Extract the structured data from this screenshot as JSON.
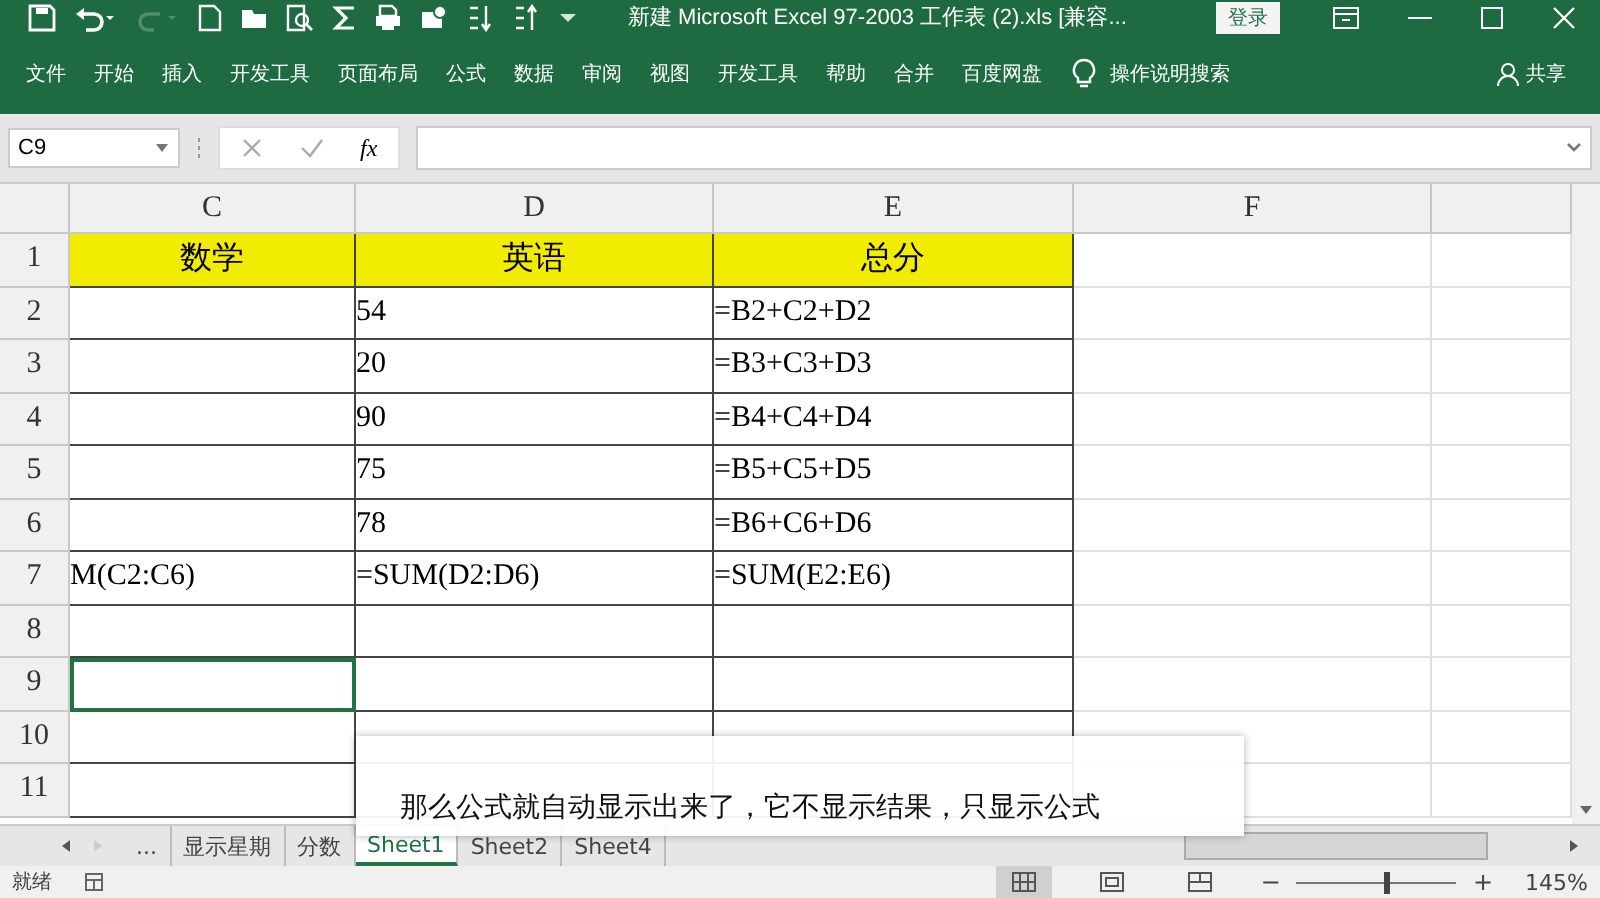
{
  "window": {
    "title": "新建 Microsoft Excel 97-2003 工作表 (2).xls  [兼容...",
    "login": "登录"
  },
  "ribbon_tabs": [
    {
      "label": "文件"
    },
    {
      "label": "开始"
    },
    {
      "label": "插入"
    },
    {
      "label": "开发工具"
    },
    {
      "label": "页面布局"
    },
    {
      "label": "公式"
    },
    {
      "label": "数据"
    },
    {
      "label": "审阅"
    },
    {
      "label": "视图"
    },
    {
      "label": "开发工具"
    },
    {
      "label": "帮助"
    },
    {
      "label": "合并"
    },
    {
      "label": "百度网盘"
    }
  ],
  "tell_me": "操作说明搜索",
  "share": "共享",
  "name_box": "C9",
  "fx": "fx",
  "columns": [
    "C",
    "D",
    "E",
    "F"
  ],
  "rows": [
    {
      "number": "1",
      "header": true,
      "cells": [
        {
          "text": "数学",
          "selected": false
        },
        {
          "text": "英语",
          "selected": false
        },
        {
          "text": "总分",
          "selected": false
        },
        {
          "text": "",
          "selected": false
        }
      ]
    },
    {
      "number": "2",
      "header": false,
      "cells": [
        {
          "text": "",
          "selected": false
        },
        {
          "text": "54",
          "selected": false
        },
        {
          "text": "=B2+C2+D2",
          "selected": false
        },
        {
          "text": "",
          "selected": false
        }
      ]
    },
    {
      "number": "3",
      "header": false,
      "cells": [
        {
          "text": "",
          "selected": false
        },
        {
          "text": "20",
          "selected": false
        },
        {
          "text": "=B3+C3+D3",
          "selected": false
        },
        {
          "text": "",
          "selected": false
        }
      ]
    },
    {
      "number": "4",
      "header": false,
      "cells": [
        {
          "text": "",
          "selected": false
        },
        {
          "text": "90",
          "selected": false
        },
        {
          "text": "=B4+C4+D4",
          "selected": false
        },
        {
          "text": "",
          "selected": false
        }
      ]
    },
    {
      "number": "5",
      "header": false,
      "cells": [
        {
          "text": "",
          "selected": false
        },
        {
          "text": "75",
          "selected": false
        },
        {
          "text": "=B5+C5+D5",
          "selected": false
        },
        {
          "text": "",
          "selected": false
        }
      ]
    },
    {
      "number": "6",
      "header": false,
      "cells": [
        {
          "text": "",
          "selected": false
        },
        {
          "text": "78",
          "selected": false
        },
        {
          "text": "=B6+C6+D6",
          "selected": false
        },
        {
          "text": "",
          "selected": false
        }
      ]
    },
    {
      "number": "7",
      "header": false,
      "cells": [
        {
          "text": "M(C2:C6)",
          "selected": false
        },
        {
          "text": "=SUM(D2:D6)",
          "selected": false
        },
        {
          "text": "=SUM(E2:E6)",
          "selected": false
        },
        {
          "text": "",
          "selected": false
        }
      ]
    },
    {
      "number": "8",
      "header": false,
      "cells": [
        {
          "text": "",
          "selected": false
        },
        {
          "text": "",
          "selected": false
        },
        {
          "text": "",
          "selected": false
        },
        {
          "text": "",
          "selected": false
        }
      ]
    },
    {
      "number": "9",
      "header": false,
      "cells": [
        {
          "text": "",
          "selected": true
        },
        {
          "text": "",
          "selected": false
        },
        {
          "text": "",
          "selected": false
        },
        {
          "text": "",
          "selected": false
        }
      ]
    },
    {
      "number": "10",
      "header": false,
      "cells": [
        {
          "text": "",
          "selected": false
        },
        {
          "text": "",
          "selected": false
        },
        {
          "text": "",
          "selected": false
        },
        {
          "text": "",
          "selected": false
        }
      ]
    },
    {
      "number": "11",
      "header": false,
      "cells": [
        {
          "text": "",
          "selected": false
        },
        {
          "text": "",
          "selected": false
        },
        {
          "text": "",
          "selected": false
        },
        {
          "text": "",
          "selected": false
        }
      ]
    }
  ],
  "sheet_tabs": [
    {
      "label": "...",
      "selected": false
    },
    {
      "label": "显示星期",
      "selected": false
    },
    {
      "label": "分数",
      "selected": false
    },
    {
      "label": "Sheet1",
      "selected": true
    },
    {
      "label": "Sheet2",
      "selected": false
    },
    {
      "label": "Sheet4",
      "selected": false
    }
  ],
  "subtitle": "那么公式就自动显示出来了，它不显示结果，只显示公式",
  "status": {
    "text": "就绪",
    "zoom_out": "−",
    "zoom_in": "+",
    "zoom": "145%",
    "zoom_level": {
      "level": 0.56
    }
  }
}
